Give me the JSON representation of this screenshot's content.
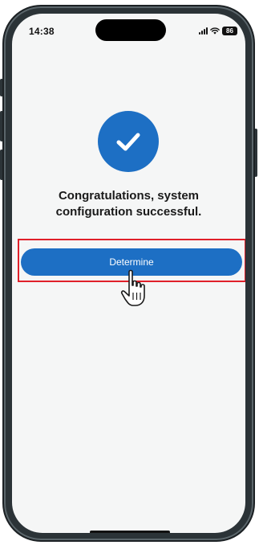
{
  "status_bar": {
    "time": "14:38",
    "battery": "86",
    "icons": [
      "signal-icon",
      "wifi-icon",
      "battery-icon"
    ]
  },
  "success": {
    "icon": "checkmark-icon",
    "message_line1": "Congratulations, system",
    "message_line2": "configuration successful."
  },
  "actions": {
    "determine_label": "Determine"
  },
  "colors": {
    "accent": "#1d6fc4",
    "highlight": "#e0202a",
    "screen_bg": "#f5f6f6",
    "frame": "#2b3337"
  }
}
